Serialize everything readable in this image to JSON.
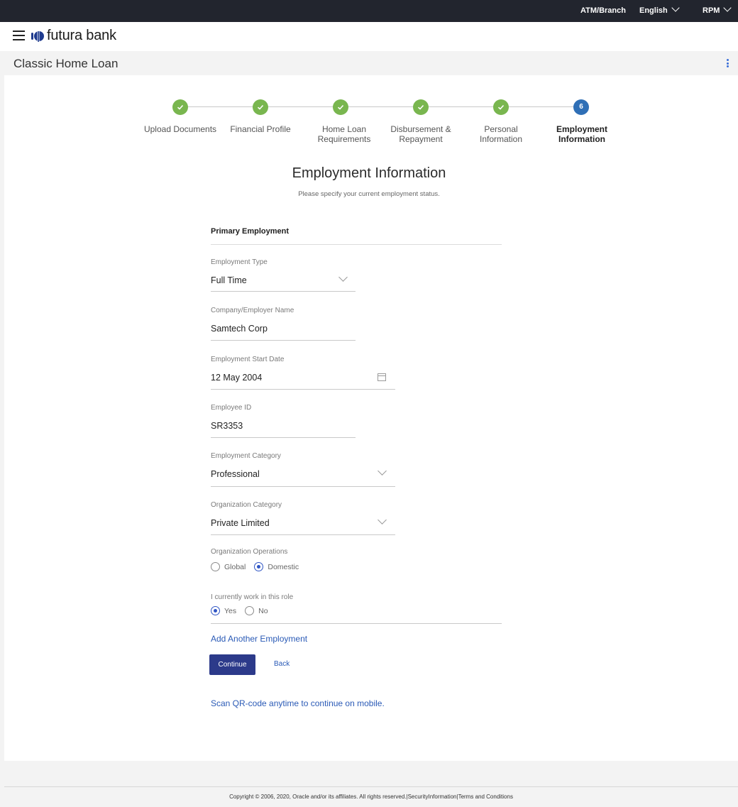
{
  "topbar": {
    "atm_branch": "ATM/Branch",
    "language": "English",
    "user": "RPM"
  },
  "brand": {
    "name": "futura bank",
    "accent": "#2c3a8a"
  },
  "page": {
    "title": "Classic Home Loan"
  },
  "stepper": {
    "steps": [
      {
        "label_1": "Upload Documents",
        "label_2": "",
        "status": "complete"
      },
      {
        "label_1": "Financial Profile",
        "label_2": "",
        "status": "complete"
      },
      {
        "label_1": "Home Loan",
        "label_2": "Requirements",
        "status": "complete"
      },
      {
        "label_1": "Disbursement &",
        "label_2": "Repayment",
        "status": "complete"
      },
      {
        "label_1": "Personal",
        "label_2": "Information",
        "status": "complete"
      },
      {
        "label_1": "Employment",
        "label_2": "Information",
        "status": "active",
        "number": "6"
      }
    ]
  },
  "section": {
    "title": "Employment Information",
    "subtitle": "Please specify your current employment status.",
    "group_title": "Primary Employment"
  },
  "form": {
    "employment_type": {
      "label": "Employment Type",
      "value": "Full Time"
    },
    "company_name": {
      "label": "Company/Employer Name",
      "value": "Samtech Corp"
    },
    "start_date": {
      "label": "Employment Start Date",
      "value": "12 May 2004"
    },
    "employee_id": {
      "label": "Employee ID",
      "value": "SR3353"
    },
    "employment_category": {
      "label": "Employment Category",
      "value": "Professional"
    },
    "organization_category": {
      "label": "Organization Category",
      "value": "Private Limited"
    },
    "organization_operations": {
      "label": "Organization Operations",
      "options": [
        "Global",
        "Domestic"
      ],
      "selected": "Domestic"
    },
    "current_role": {
      "label": "I currently work in this role",
      "options": [
        "Yes",
        "No"
      ],
      "selected": "Yes"
    }
  },
  "actions": {
    "add_employment": "Add Another Employment",
    "continue": "Continue",
    "back": "Back",
    "qr_link": "Scan QR-code anytime to continue on mobile."
  },
  "footer": {
    "text": "Copyright © 2006, 2020, Oracle and/or its affiliates. All rights reserved.|SecurityInformation|Terms and Conditions"
  }
}
